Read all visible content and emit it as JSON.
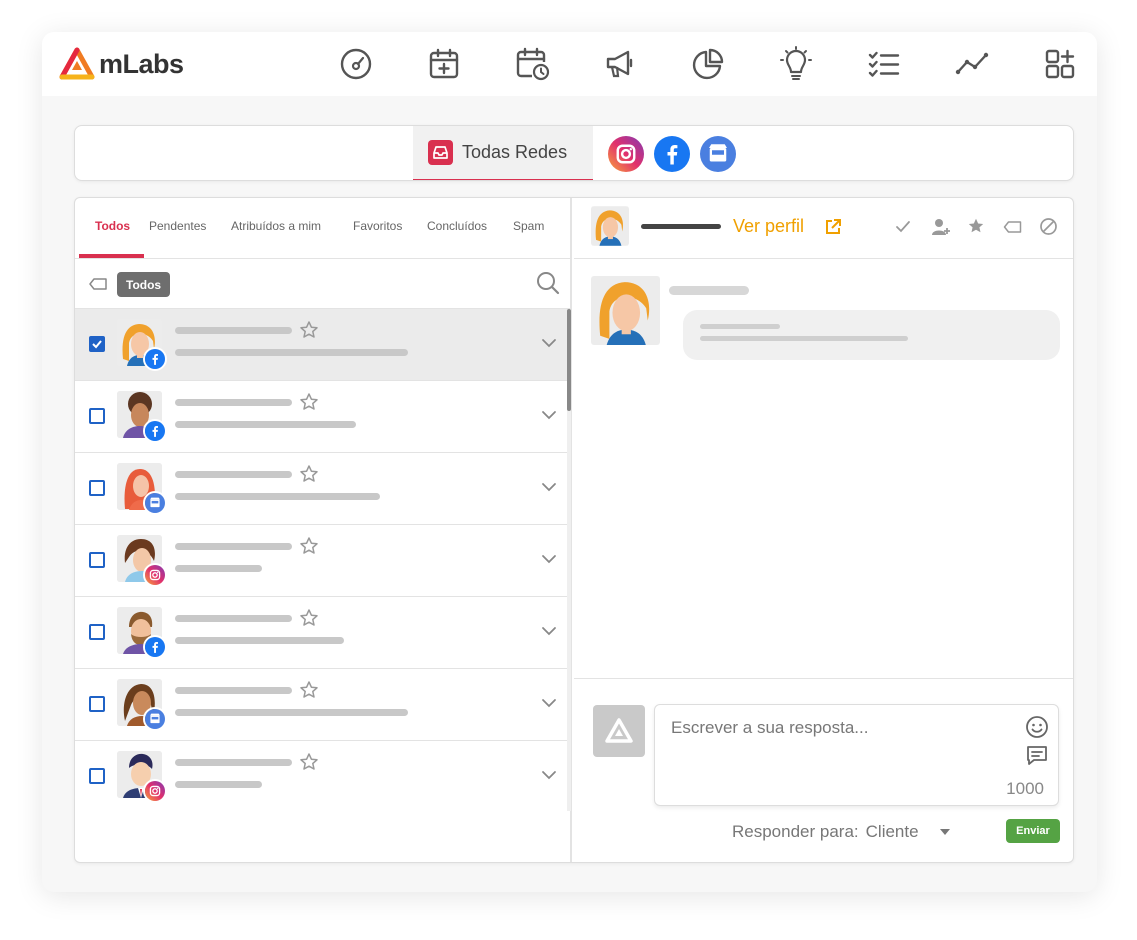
{
  "app": {
    "logo_text": "mLabs"
  },
  "topnav": {
    "icons": [
      "dashboard-icon",
      "calendar-add-icon",
      "calendar-clock-icon",
      "megaphone-icon",
      "pie-chart-icon",
      "lightbulb-icon",
      "checklist-icon",
      "trend-line-icon",
      "apps-add-icon"
    ]
  },
  "networks": {
    "all_label": "Todas Redes",
    "items": [
      "instagram-icon",
      "facebook-icon",
      "google-business-icon"
    ]
  },
  "filters": {
    "tabs": [
      "Todos",
      "Pendentes",
      "Atribuídos a mim",
      "Favoritos",
      "Concluídos",
      "Spam"
    ],
    "active": "Todos",
    "tag_chip": "Todos"
  },
  "conversations": [
    {
      "network": "facebook",
      "selected": true,
      "checked": true
    },
    {
      "network": "facebook",
      "selected": false,
      "checked": false
    },
    {
      "network": "google-business",
      "selected": false,
      "checked": false
    },
    {
      "network": "instagram",
      "selected": false,
      "checked": false
    },
    {
      "network": "facebook",
      "selected": false,
      "checked": false
    },
    {
      "network": "google-business",
      "selected": false,
      "checked": false
    },
    {
      "network": "instagram",
      "selected": false,
      "checked": false
    }
  ],
  "chat": {
    "view_profile": "Ver perfil",
    "actions": [
      "check-icon",
      "assign-user-icon",
      "star-icon",
      "tag-icon",
      "block-icon"
    ]
  },
  "reply": {
    "placeholder": "Escrever a sua resposta...",
    "char_count": "1000",
    "responder_label": "Responder para:",
    "responder_value": "Cliente",
    "send_label": "Enviar"
  },
  "colors": {
    "accent": "#d9304f",
    "link": "#f0a000",
    "checkbox": "#1f62c6",
    "send": "#55a344",
    "facebook": "#1877f2",
    "google_business": "#4a7fe0"
  }
}
